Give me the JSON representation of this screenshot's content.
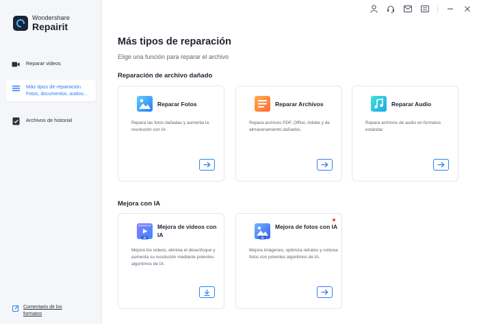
{
  "brand": {
    "company": "Wondershare",
    "product": "Repairit"
  },
  "sidebar": {
    "items": [
      {
        "label": "Reparar videos",
        "sub": "",
        "icon": "video-camera-icon"
      },
      {
        "label": "Más tipos de reparación",
        "sub": "Fotos, documentos, audios...",
        "icon": "list-icon",
        "active": true
      },
      {
        "label": "Archivos de historial",
        "sub": "",
        "icon": "checklist-icon"
      }
    ],
    "feedback": "Comentario de los formatos"
  },
  "topbar": {
    "icons": [
      "user-icon",
      "headset-icon",
      "mail-icon",
      "menu-icon",
      "minimize-icon",
      "close-icon"
    ]
  },
  "main": {
    "title": "Más tipos de reparación",
    "subtitle": "Elige una función para reparar el archivo",
    "sections": [
      {
        "title": "Reparación de archivo dañado",
        "cards": [
          {
            "title": "Reparar Fotos",
            "desc": "Repara las fotos dañadas y aumenta la resolución con IA.",
            "icon": "photo-icon",
            "action": "arrow-right-icon"
          },
          {
            "title": "Reparar Archivos",
            "desc": "Repara archivos PDF, Office, Adobe y de almacenamiento dañados.",
            "icon": "document-icon",
            "action": "arrow-right-icon"
          },
          {
            "title": "Reparar Audio",
            "desc": "Repara archivos de audio en formatos estándar.",
            "icon": "music-icon",
            "action": "arrow-right-icon"
          }
        ]
      },
      {
        "title": "Mejora con IA",
        "cards": [
          {
            "title": "Mejora de videos con IA",
            "desc": "Mejora los videos, elimina el desenfoque y aumenta su resolución mediante potentes algoritmos de IA.",
            "icon": "ai-video-icon",
            "badge": "AI",
            "action": "download-icon"
          },
          {
            "title": "Mejora de fotos con IA",
            "desc": "Mejora imágenes, optimiza retratos y colorea fotos con potentes algoritmos de IA.",
            "icon": "ai-photo-icon",
            "badge": "AI",
            "action": "arrow-right-icon",
            "new_dot": true
          }
        ]
      }
    ]
  },
  "colors": {
    "accent": "#2a7cf6",
    "sidebar_bg": "#f4f6f9",
    "new_dot": "#ff3b3b"
  }
}
